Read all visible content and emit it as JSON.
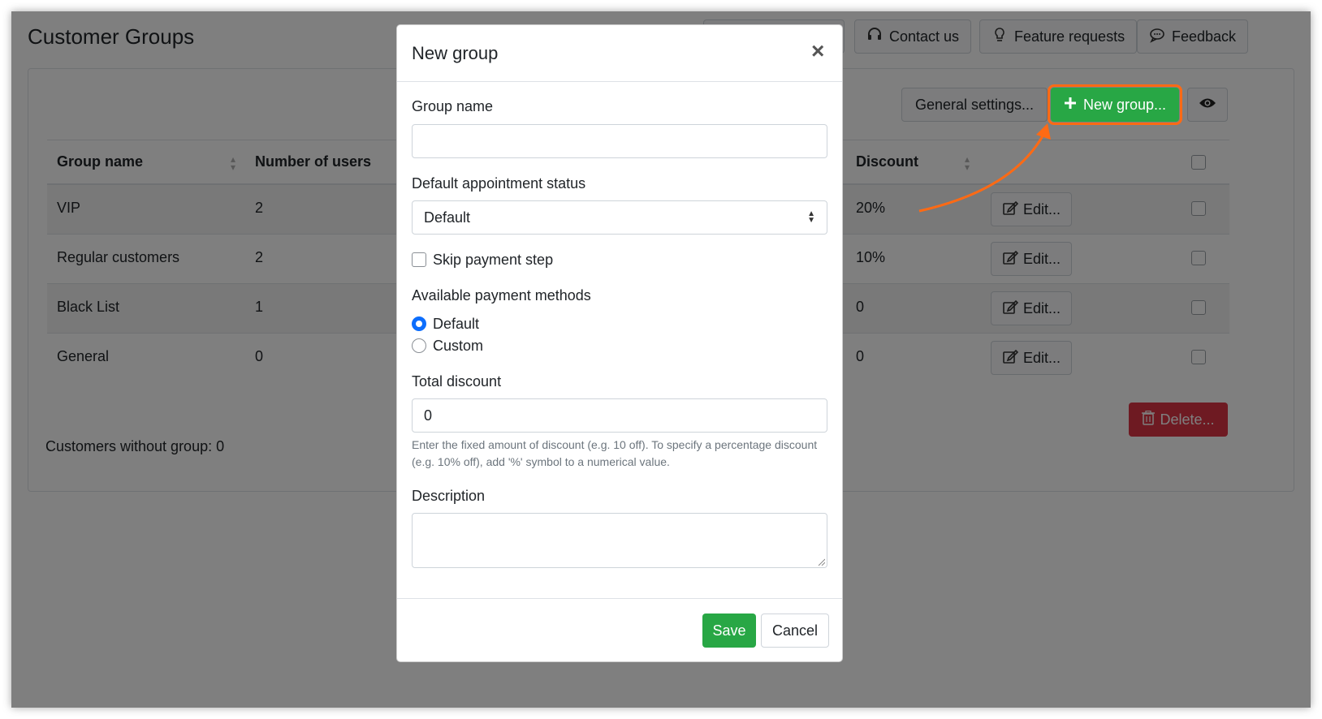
{
  "page": {
    "title": "Customer Groups"
  },
  "top_buttons": {
    "contact": "Contact us",
    "features": "Feature requests",
    "feedback": "Feedback"
  },
  "toolbar": {
    "general_settings": "General settings...",
    "new_group": "New group...",
    "delete": "Delete..."
  },
  "table": {
    "columns": {
      "group_name": "Group name",
      "users": "Number of users",
      "discount": "Discount"
    },
    "rows": [
      {
        "name": "VIP",
        "users": "2",
        "discount": "20%",
        "edit": "Edit..."
      },
      {
        "name": "Regular customers",
        "users": "2",
        "discount": "10%",
        "edit": "Edit..."
      },
      {
        "name": "Black List",
        "users": "1",
        "discount": "0",
        "edit": "Edit..."
      },
      {
        "name": "General",
        "users": "0",
        "discount": "0",
        "edit": "Edit..."
      }
    ]
  },
  "footer": {
    "without_group": "Customers without group: 0"
  },
  "modal": {
    "title": "New group",
    "close": "×",
    "group_name_label": "Group name",
    "group_name_value": "",
    "status_label": "Default appointment status",
    "status_value": "Default",
    "skip_payment_label": "Skip payment step",
    "skip_payment_checked": false,
    "payment_methods_label": "Available payment methods",
    "payment_default": "Default",
    "payment_custom": "Custom",
    "payment_selected": "Default",
    "discount_label": "Total discount",
    "discount_value": "0",
    "discount_help": "Enter the fixed amount of discount (e.g. 10 off). To specify a percentage discount (e.g. 10% off), add '%' symbol to a numerical value.",
    "description_label": "Description",
    "description_value": "",
    "save": "Save",
    "cancel": "Cancel"
  },
  "colors": {
    "success": "#28a745",
    "danger": "#dc3545",
    "primary": "#0d6efd",
    "annotation": "#ff6a14"
  }
}
